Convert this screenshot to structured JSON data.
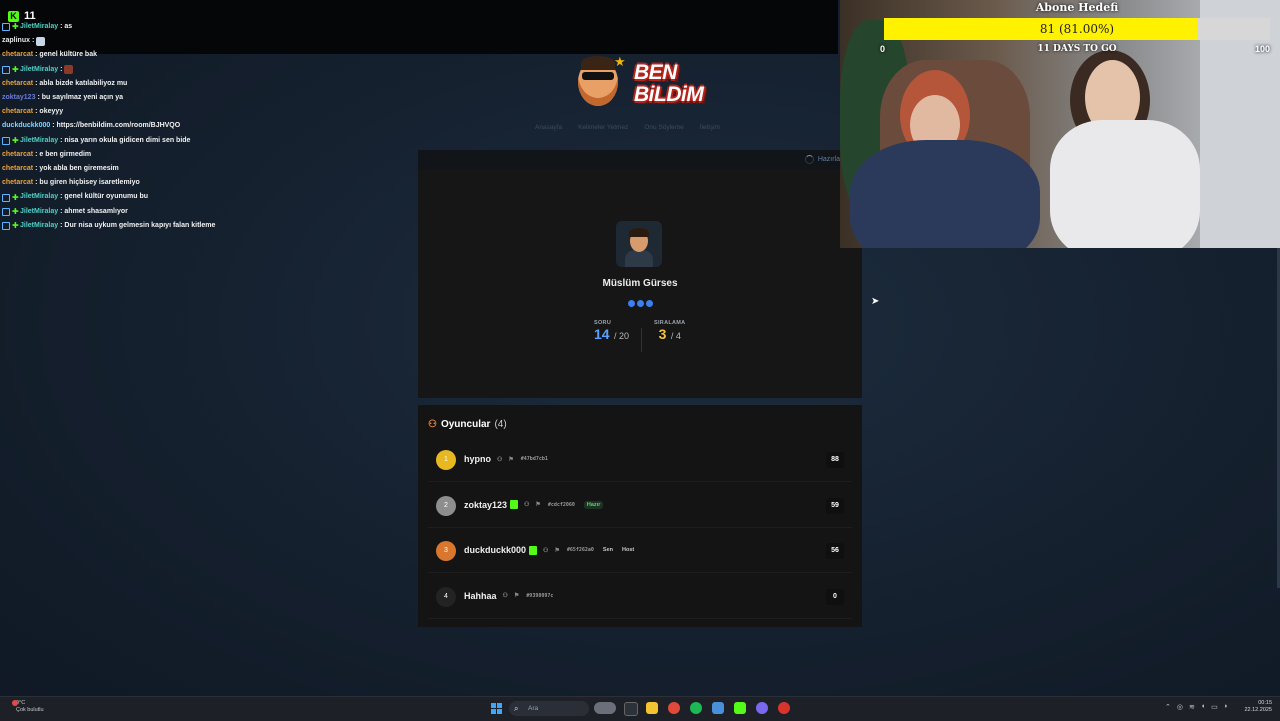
{
  "stream": {
    "viewer_count": "11"
  },
  "chat": [
    {
      "user": "JiletMiralay",
      "color": "#4fd1c5",
      "badge": true,
      "message": ": as"
    },
    {
      "user": "zaplinux",
      "color": "#e8e8e8",
      "badge": false,
      "message": ":",
      "emote": "light"
    },
    {
      "user": "chetarcat",
      "color": "#e9a23b",
      "badge": false,
      "message": ": genel kültüre bak"
    },
    {
      "user": "JiletMiralay",
      "color": "#4fd1c5",
      "badge": true,
      "message": ":",
      "emote": "red"
    },
    {
      "user": "chetarcat",
      "color": "#e9a23b",
      "badge": false,
      "message": ": abla bizde katılabiliyoz mu"
    },
    {
      "user": "zoktay123",
      "color": "#6b7bd6",
      "badge": false,
      "message": ": bu sayılmaz yeni açın ya"
    },
    {
      "user": "chetarcat",
      "color": "#e9a23b",
      "badge": false,
      "message": ": okeyyy"
    },
    {
      "user": "duckduckk000",
      "color": "#7fd6ff",
      "badge": false,
      "message": ": https://benbildim.com/room/BJHVQO"
    },
    {
      "user": "JiletMiralay",
      "color": "#4fd1c5",
      "badge": true,
      "message": ": nisa yarın okula gidicen dimi sen bide"
    },
    {
      "user": "chetarcat",
      "color": "#e9a23b",
      "badge": false,
      "message": ": e ben girmedim"
    },
    {
      "user": "chetarcat",
      "color": "#e9a23b",
      "badge": false,
      "message": ": yok abla ben giremesim"
    },
    {
      "user": "chetarcat",
      "color": "#e9a23b",
      "badge": false,
      "message": ": bu giren hiçbisey isaretlemiyo"
    },
    {
      "user": "JiletMiralay",
      "color": "#4fd1c5",
      "badge": true,
      "message": ": genel kültür oyunumu bu"
    },
    {
      "user": "JiletMiralay",
      "color": "#4fd1c5",
      "badge": true,
      "message": ": ahmet shasamlıyor"
    },
    {
      "user": "JiletMiralay",
      "color": "#4fd1c5",
      "badge": true,
      "message": ": Dur nisa uykum gelmesin kapıyı falan kitleme"
    }
  ],
  "site": {
    "logo_text_1": "BEN",
    "logo_text_2": "BiLDiM",
    "nav": [
      "Anasayfa",
      "Kelimeler Yetmez",
      "Onu Söyleme",
      "İletişim"
    ],
    "status": "Hazırla"
  },
  "player_card": {
    "name": "Müslüm Gürses",
    "question_label": "SORU",
    "question_current": "14",
    "question_total": "/ 20",
    "rank_label": "SIRALAMA",
    "rank_current": "3",
    "rank_total": "/ 4",
    "question_color": "#5aa0ff",
    "rank_color": "#f5c542"
  },
  "players": {
    "title": "Oyuncular",
    "count": "(4)",
    "rows": [
      {
        "rank": "1",
        "rank_color": "#e8b820",
        "name": "hypno",
        "kick": false,
        "hex": "#47bd7cb1",
        "tags": [],
        "score": "88"
      },
      {
        "rank": "2",
        "rank_color": "#8e8e8e",
        "name": "zoktay123",
        "kick": true,
        "hex": "#cdcf2060",
        "tags": [
          {
            "text": "Hazır",
            "ready": true
          }
        ],
        "score": "59"
      },
      {
        "rank": "3",
        "rank_color": "#d9772e",
        "name": "duckduckk000",
        "kick": true,
        "hex": "#65f262a0",
        "tags": [
          {
            "text": "Sen",
            "ready": false
          },
          {
            "text": "Host",
            "ready": false
          }
        ],
        "score": "56"
      },
      {
        "rank": "4",
        "rank_color": "#232323",
        "name": "Hahhaa",
        "kick": false,
        "hex": "#9398097c",
        "tags": [],
        "score": "0"
      }
    ]
  },
  "sub_goal": {
    "title": "Abone Hedefi",
    "text": "81 (81.00%)",
    "progress": 0.81,
    "days": "11 DAYS TO GO",
    "min": "0",
    "max": "100"
  },
  "taskbar": {
    "weather_temp": "9°C",
    "weather_desc": "Çok bulutlu",
    "search_placeholder": "Ara",
    "time": "00:15",
    "date": "22.12.2025"
  }
}
